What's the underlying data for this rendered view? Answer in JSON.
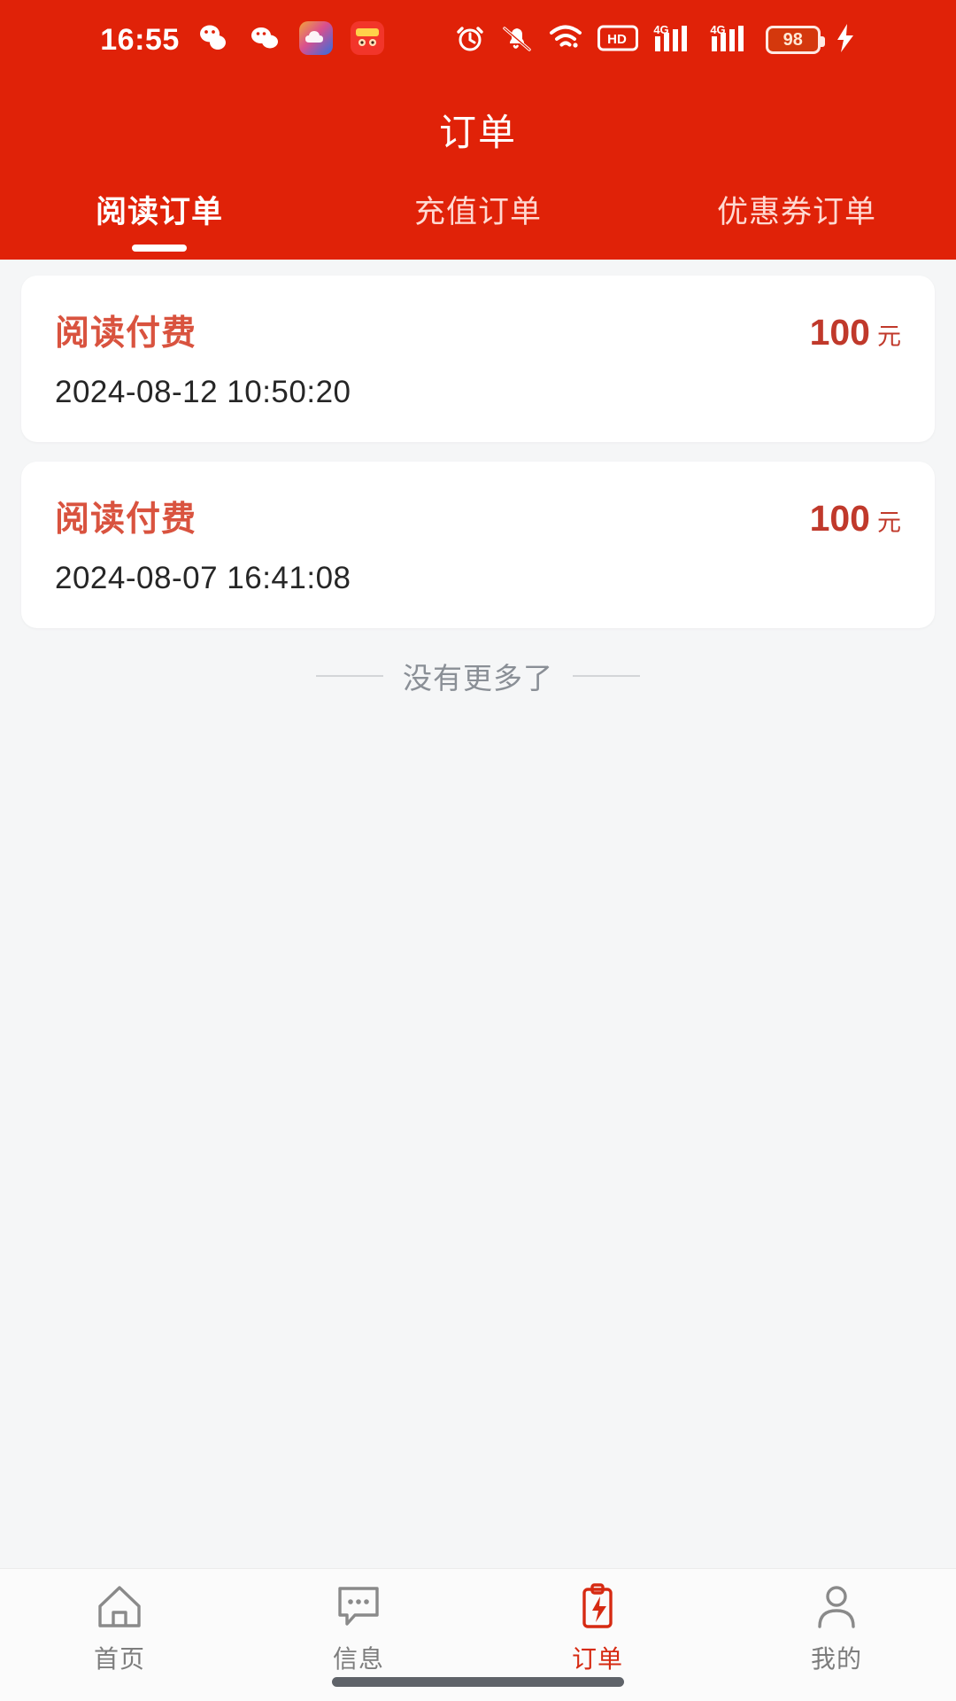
{
  "status_bar": {
    "time": "16:55",
    "battery_level": "98",
    "icons_left": [
      "wechat-work-icon",
      "wechat-icon",
      "cloud-app-icon",
      "red-app-icon"
    ],
    "icons_right": [
      "alarm-icon",
      "bell-muted-icon",
      "wifi-icon",
      "hd-icon",
      "signal-4g-1-icon",
      "signal-4g-2-icon",
      "battery-icon",
      "charging-bolt-icon"
    ],
    "network_label": "4G",
    "hd_label": "HD"
  },
  "header": {
    "title": "订单",
    "tabs": [
      {
        "label": "阅读订单",
        "active": true
      },
      {
        "label": "充值订单",
        "active": false
      },
      {
        "label": "优惠券订单",
        "active": false
      }
    ]
  },
  "orders": [
    {
      "title": "阅读付费",
      "amount": "100",
      "unit": "元",
      "date": "2024-08-12 10:50:20"
    },
    {
      "title": "阅读付费",
      "amount": "100",
      "unit": "元",
      "date": "2024-08-07 16:41:08"
    }
  ],
  "list_footer": {
    "text": "没有更多了"
  },
  "bottom_nav": [
    {
      "label": "首页",
      "icon": "home-icon",
      "active": false
    },
    {
      "label": "信息",
      "icon": "message-icon",
      "active": false
    },
    {
      "label": "订单",
      "icon": "order-clipboard-icon",
      "active": true
    },
    {
      "label": "我的",
      "icon": "person-icon",
      "active": false
    }
  ],
  "colors": {
    "brand_red": "#e02208",
    "accent_red": "#d62a12",
    "card_title_red": "#d9533f",
    "page_bg": "#f5f6f7"
  }
}
